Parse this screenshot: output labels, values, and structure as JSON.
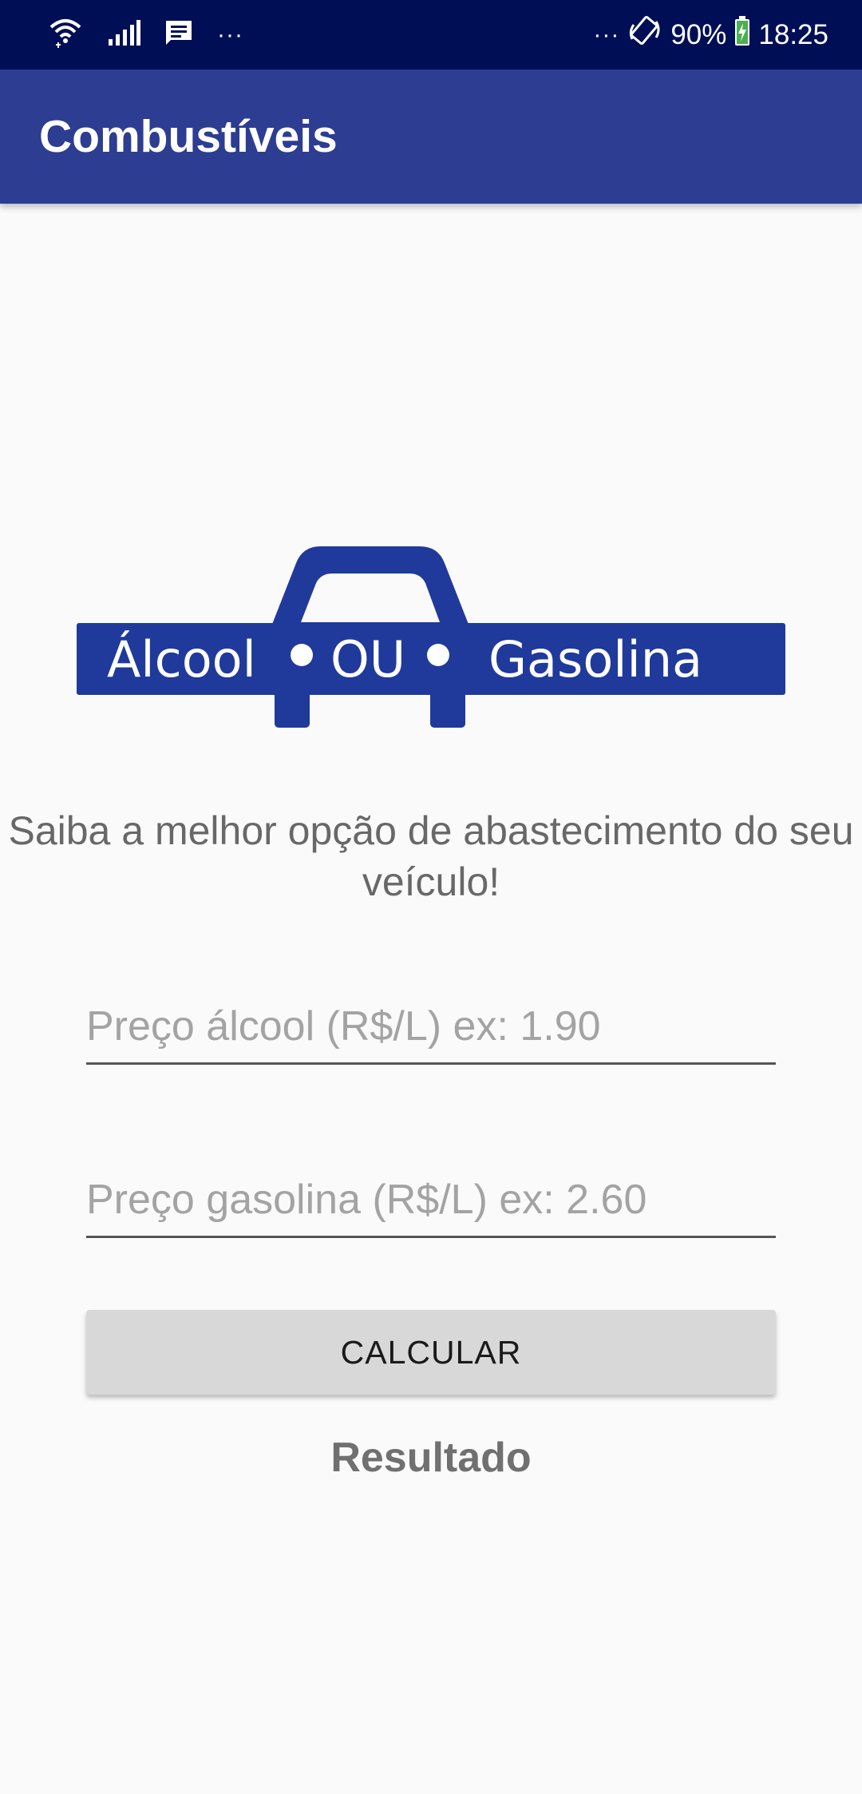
{
  "status_bar": {
    "left_dots": "···",
    "right_dots": "···",
    "battery": "90%",
    "time": "18:25",
    "icons": [
      "wifi-icon",
      "signal-icon",
      "message-icon",
      "rotation-lock-icon",
      "battery-charging-icon"
    ]
  },
  "app_bar": {
    "title": "Combustíveis"
  },
  "logo": {
    "text_left": "Álcool",
    "text_middle": "OU",
    "text_right": "Gasolina",
    "color": "#1f3a9a"
  },
  "main": {
    "subtitle": "Saiba a melhor opção de abastecimento do seu veículo!",
    "alcool_field": {
      "value": "",
      "placeholder": "Preço álcool (R$/L) ex: 1.90"
    },
    "gasolina_field": {
      "value": "",
      "placeholder": "Preço gasolina (R$/L) ex: 2.60"
    },
    "calculate_label": "CALCULAR",
    "result_label": "Resultado"
  },
  "colors": {
    "status_bar": "#000f55",
    "app_bar": "#2c3d92",
    "logo_blue": "#1f3a9a",
    "button": "#d7d8d7"
  }
}
